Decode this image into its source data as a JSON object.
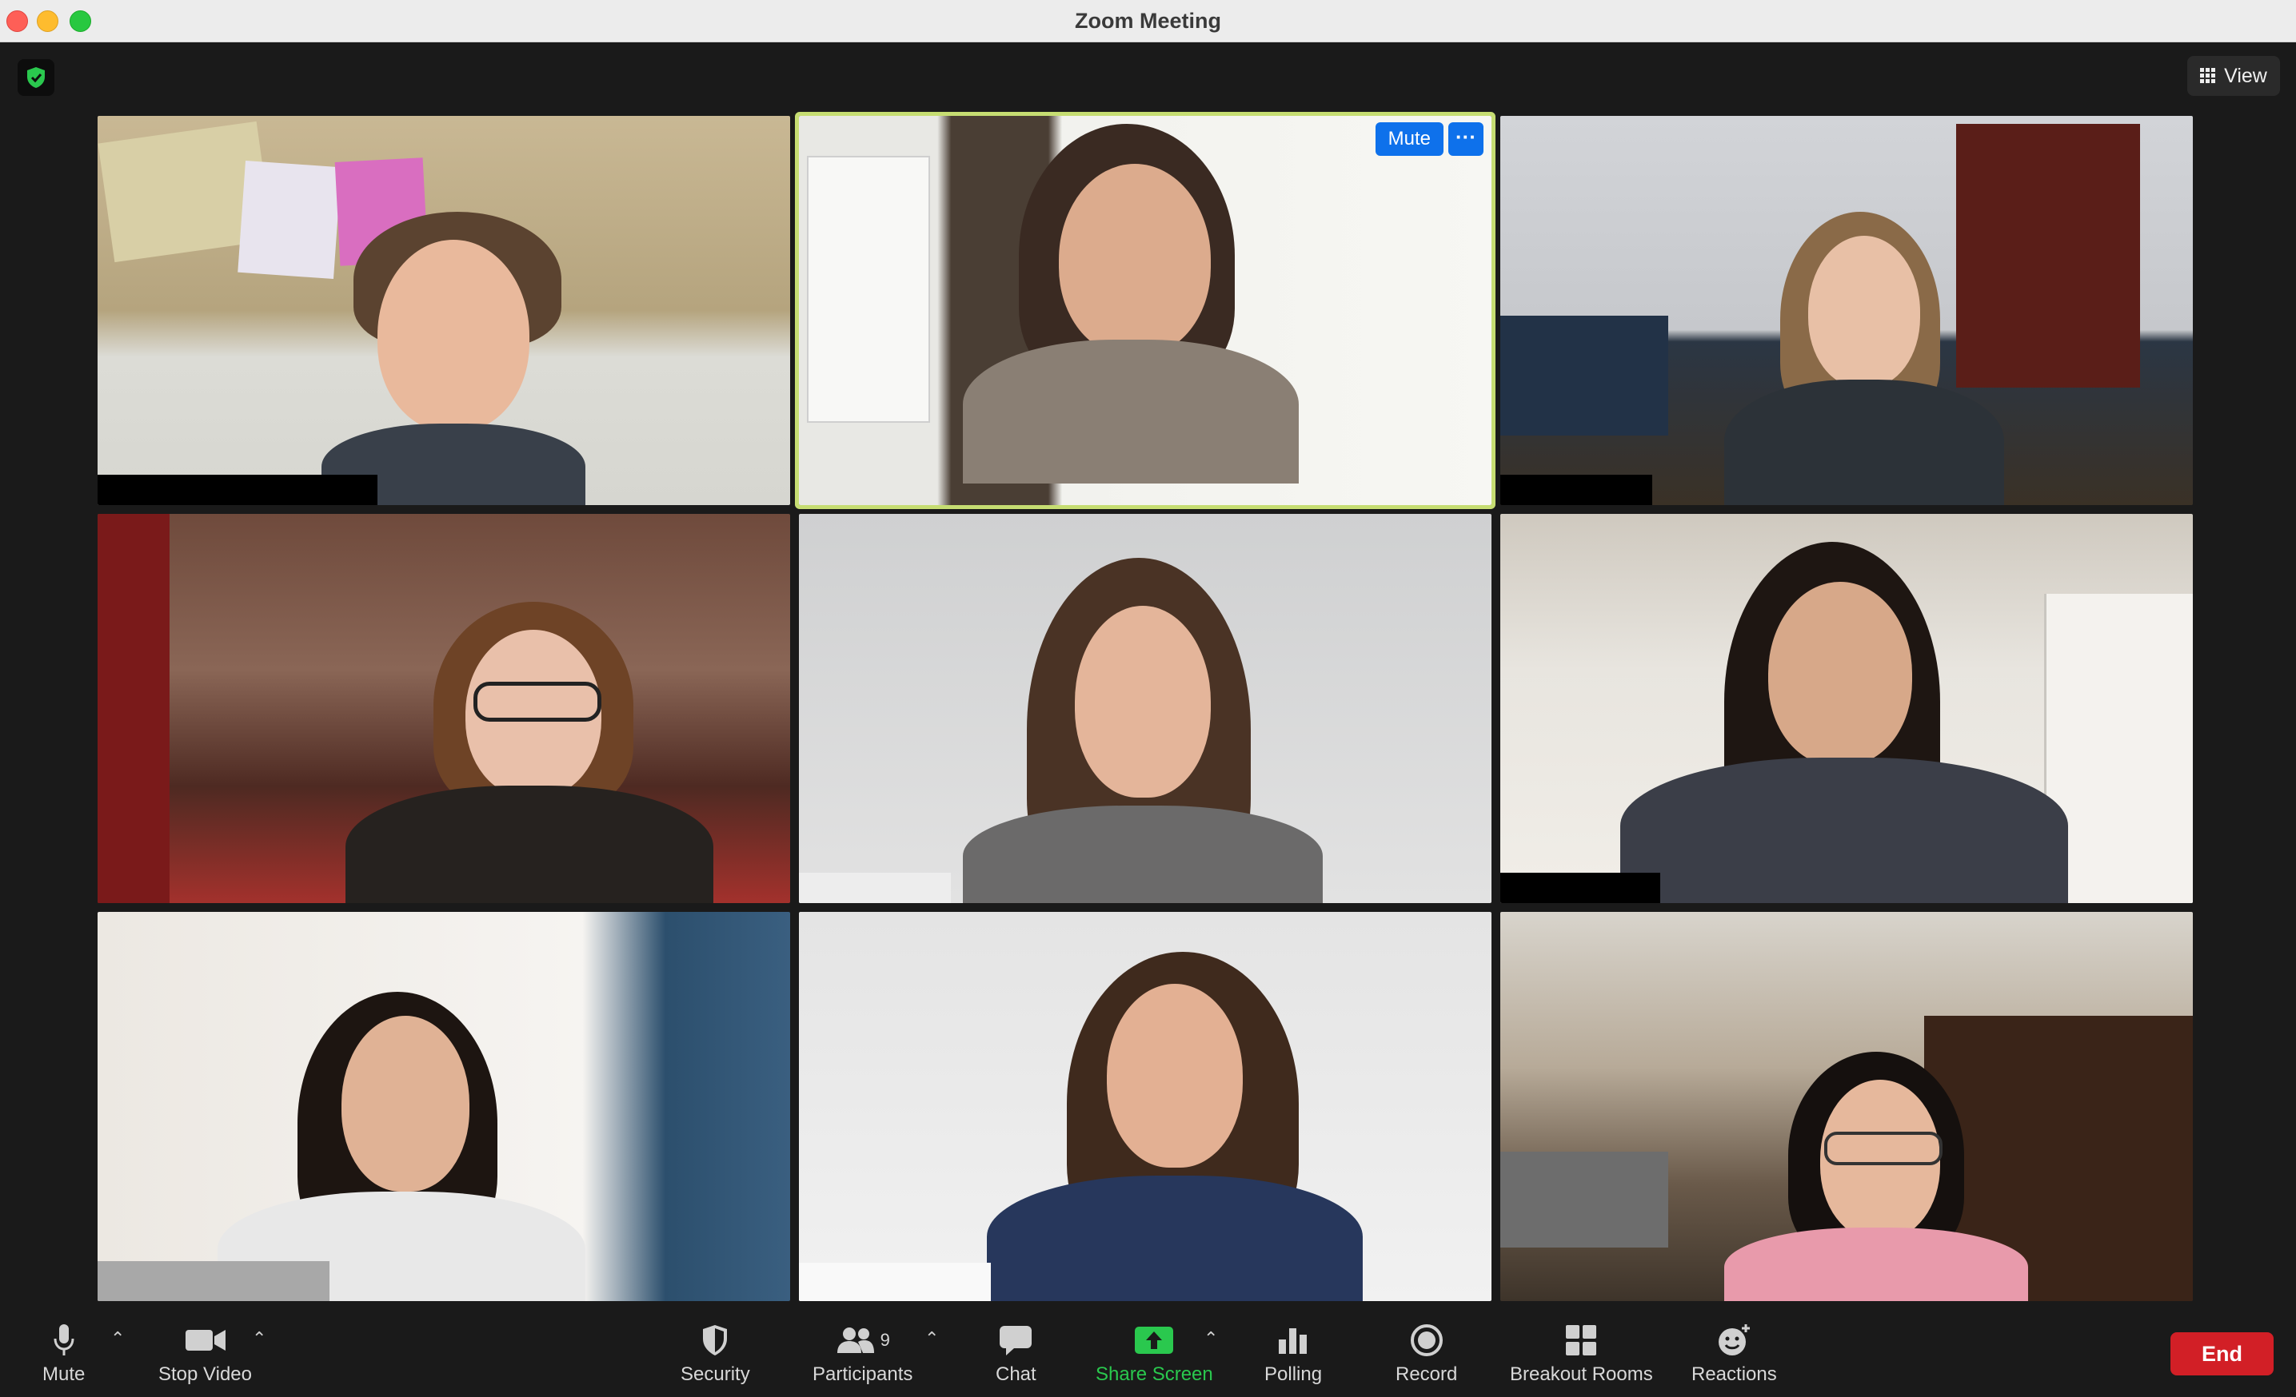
{
  "window": {
    "title": "Zoom Meeting"
  },
  "top_bar": {
    "view_label": "View",
    "security_badge_color": "#2ac84e"
  },
  "active_speaker_controls": {
    "mute_label": "Mute",
    "more_label": "···"
  },
  "toolbar": {
    "mute_label": "Mute",
    "stop_video_label": "Stop Video",
    "security_label": "Security",
    "participants_label": "Participants",
    "participants_count": "9",
    "chat_label": "Chat",
    "share_screen_label": "Share Screen",
    "polling_label": "Polling",
    "record_label": "Record",
    "breakout_rooms_label": "Breakout Rooms",
    "reactions_label": "Reactions",
    "end_label": "End"
  },
  "colors": {
    "active_speaker_border": "#c6dd72",
    "share_green": "#2ac84e",
    "end_red": "#d21f26",
    "button_blue": "#0e71eb"
  }
}
